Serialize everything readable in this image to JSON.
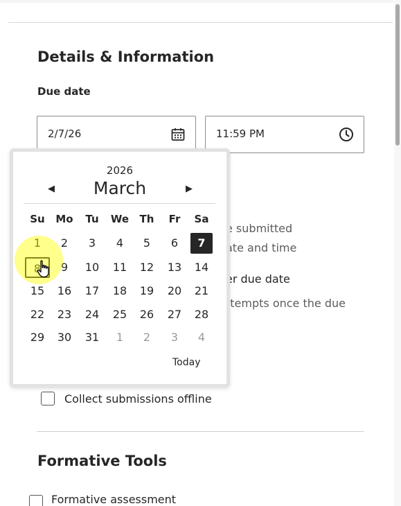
{
  "section": {
    "title": "Details & Information",
    "due_date_label": "Due date",
    "due_date_value": "2/7/26",
    "due_time_value": "11:59 PM"
  },
  "background_text": {
    "line1": "e submitted",
    "line2": "ate and time",
    "line3": "er due date",
    "line4": "ttempts once the due"
  },
  "offline_checkbox": {
    "label": "Collect submissions offline",
    "checked": false
  },
  "formative": {
    "title": "Formative Tools",
    "checkbox_label": "Formative assessment"
  },
  "datepicker": {
    "year": "2026",
    "month": "March",
    "today_label": "Today",
    "weekdays": [
      "Su",
      "Mo",
      "Tu",
      "We",
      "Th",
      "Fr",
      "Sa"
    ],
    "weeks": [
      [
        "1",
        "2",
        "3",
        "4",
        "5",
        "6",
        "7"
      ],
      [
        "8",
        "9",
        "10",
        "11",
        "12",
        "13",
        "14"
      ],
      [
        "15",
        "16",
        "17",
        "18",
        "19",
        "20",
        "21"
      ],
      [
        "22",
        "23",
        "24",
        "25",
        "26",
        "27",
        "28"
      ],
      [
        "29",
        "30",
        "31",
        "1",
        "2",
        "3",
        "4"
      ]
    ],
    "selected_day": "7",
    "focused_day": "8"
  },
  "colors": {
    "selected_bg": "#262626",
    "cursor_highlight": "#ffff00"
  }
}
